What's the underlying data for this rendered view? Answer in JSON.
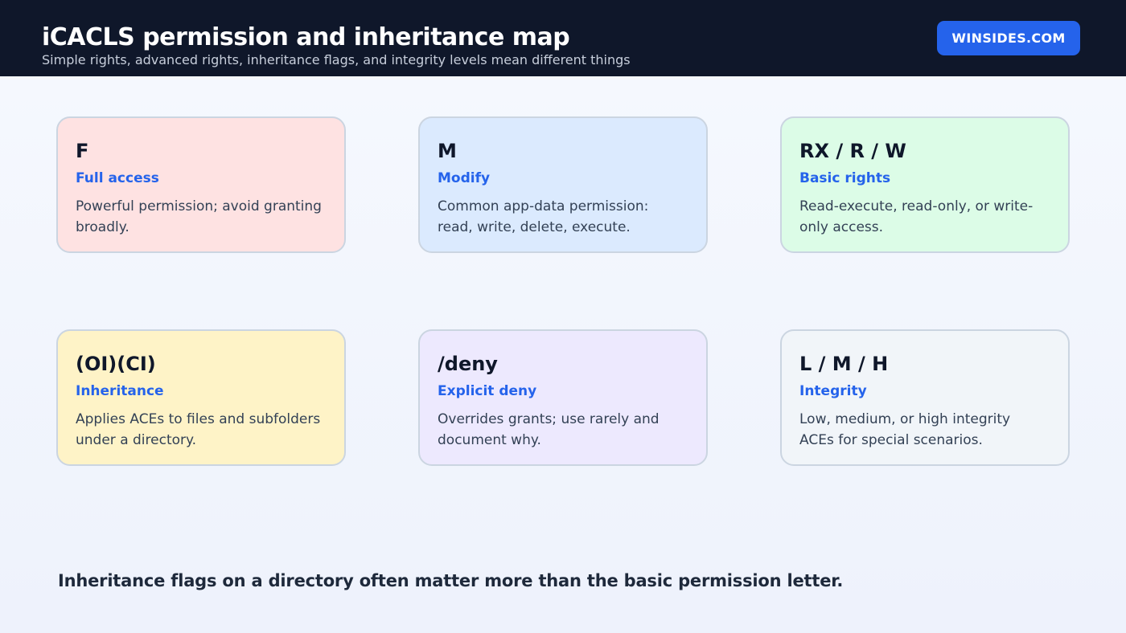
{
  "header": {
    "title": "iCACLS permission and inheritance map",
    "subtitle": "Simple rights, advanced rights, inheritance flags, and integrity levels mean different things",
    "brand": "WINSIDES.COM"
  },
  "cards": [
    {
      "code": "F",
      "label": "Full access",
      "description": "Powerful permission; avoid granting broadly.",
      "color": "#fee2e2"
    },
    {
      "code": "M",
      "label": "Modify",
      "description": "Common app-data permission: read, write, delete, execute.",
      "color": "#dbeafe"
    },
    {
      "code": "RX / R / W",
      "label": "Basic rights",
      "description": "Read-execute, read-only, or write-only access.",
      "color": "#dcfce7"
    },
    {
      "code": "(OI)(CI)",
      "label": "Inheritance",
      "description": "Applies ACEs to files and subfolders under a directory.",
      "color": "#fef3c7"
    },
    {
      "code": "/deny",
      "label": "Explicit deny",
      "description": "Overrides grants; use rarely and document why.",
      "color": "#ede9fe"
    },
    {
      "code": "L / M / H",
      "label": "Integrity",
      "description": "Low, medium, or high integrity ACEs for special scenarios.",
      "color": "#f1f5f9"
    }
  ],
  "footer": {
    "note": "Inheritance flags on a directory often matter more than the basic permission letter."
  },
  "colors": {
    "header_bg": "#0f172a",
    "accent": "#2563eb",
    "card_border": "#cbd5e1"
  }
}
